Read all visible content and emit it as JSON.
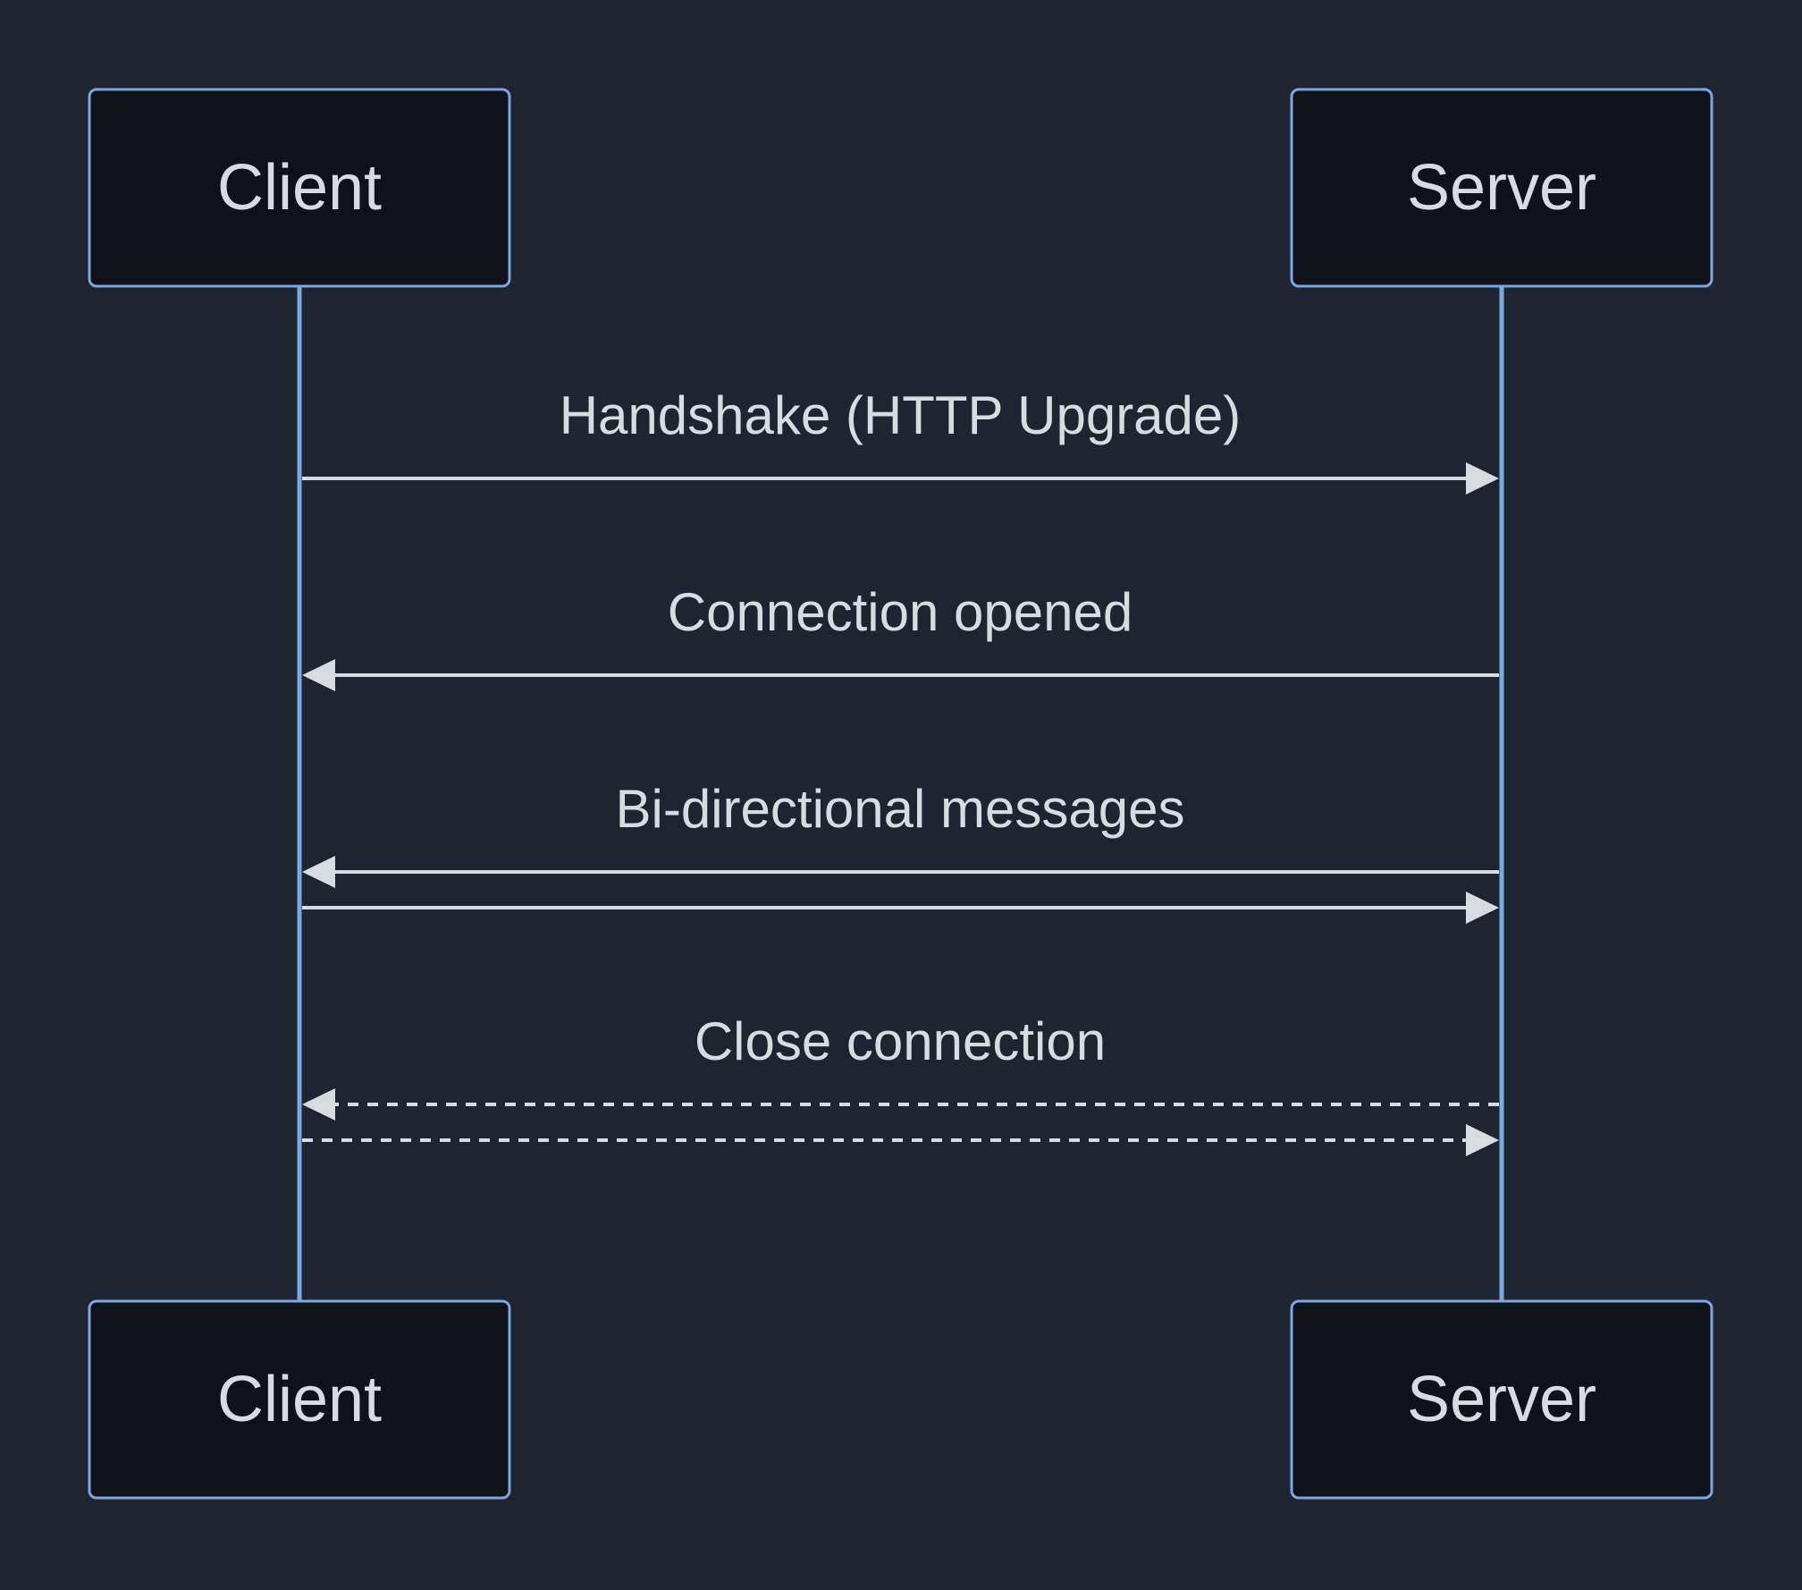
{
  "diagram": {
    "type": "sequence",
    "actors": {
      "client_top": "Client",
      "server_top": "Server",
      "client_bottom": "Client",
      "server_bottom": "Server"
    },
    "messages": [
      {
        "label": "Handshake (HTTP Upgrade)",
        "from": "Client",
        "to": "Server",
        "style": "solid",
        "direction": "right"
      },
      {
        "label": "Connection opened",
        "from": "Server",
        "to": "Client",
        "style": "solid",
        "direction": "left"
      },
      {
        "label": "Bi-directional messages",
        "from": "Client",
        "to": "Server",
        "style": "solid",
        "direction": "both"
      },
      {
        "label": "Close connection",
        "from": "Client",
        "to": "Server",
        "style": "dashed",
        "direction": "both"
      }
    ],
    "colors": {
      "background": "#1e2430",
      "box_fill": "#0f1218",
      "stroke": "#7aa8e0",
      "text": "#d8dce0"
    }
  }
}
